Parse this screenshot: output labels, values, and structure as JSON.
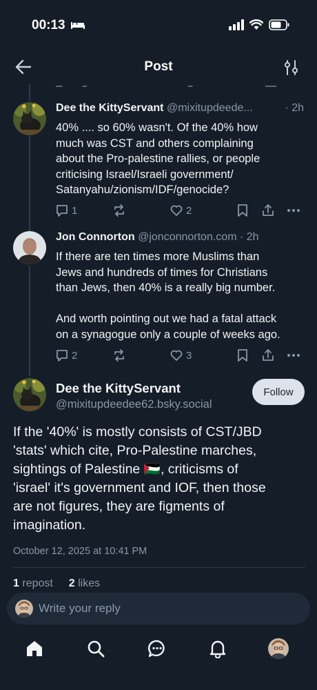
{
  "status_bar": {
    "time": "00:13"
  },
  "nav": {
    "title": "Post"
  },
  "thread": [
    {
      "author": "Dee the KittyServant",
      "handle": "@mixitupdeede...",
      "time": "· 2h",
      "lines": [
        "40% .... so 60% wasn't.  Of the 40% how",
        "much was CST and others complaining",
        "about the Pro-palestine rallies, or people",
        "criticising Israel/Israeli government/",
        "Satanyahu/zionism/IDF/genocide?"
      ],
      "reply_count": "1",
      "like_count": "2"
    },
    {
      "author": "Jon Connorton",
      "handle": "@jonconnorton.com",
      "time": "· 2h",
      "lines": [
        "If there are ten times more Muslims than",
        "Jews and hundreds of times for Christians",
        "than Jews, then 40% is a really big number.",
        "",
        "And worth pointing out we had a fatal attack",
        "on a synagogue only a couple of weeks ago."
      ],
      "reply_count": "2",
      "like_count": "3"
    }
  ],
  "main_post": {
    "author": "Dee the KittyServant",
    "handle": "@mixitupdeedee62.bsky.social",
    "follow_label": "Follow",
    "lines": [
      "If the '40%' is mostly consists of CST/JBD",
      "'stats' which cite, Pro-Palestine marches,",
      "sightings of Palestine 🇵🇸,  criticisms of",
      "'israel' it's government and IOF, then those",
      "are not figures, they are figments of",
      "imagination."
    ],
    "timestamp": "October 12, 2025 at 10:41 PM",
    "repost_count": "1",
    "repost_label": "repost",
    "like_count": "2",
    "like_label": "likes"
  },
  "reply": {
    "placeholder": "Write your reply"
  },
  "colors": {
    "background": "#151d28",
    "muted": "#8997a8",
    "text": "#f1f3f5"
  },
  "icons": [
    "back-arrow-icon",
    "filter-icon",
    "reply-icon",
    "repost-icon",
    "like-icon",
    "bookmark-icon",
    "share-icon",
    "more-icon",
    "home-icon",
    "search-icon",
    "chat-icon",
    "bell-icon"
  ]
}
